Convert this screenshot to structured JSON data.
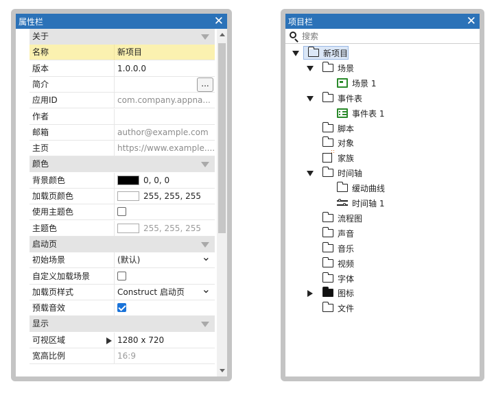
{
  "properties_panel": {
    "title": "属性栏",
    "close_label": "✕",
    "rows": [
      {
        "type": "section",
        "label": "关于"
      },
      {
        "type": "prop",
        "label": "名称",
        "value": "新项目",
        "selected": true
      },
      {
        "type": "prop",
        "label": "版本",
        "value": "1.0.0.0"
      },
      {
        "type": "prop",
        "label": "简介",
        "value": "",
        "button": "..."
      },
      {
        "type": "prop",
        "label": "应用ID",
        "value": "com.company.appna...",
        "grey": true
      },
      {
        "type": "prop",
        "label": "作者",
        "value": ""
      },
      {
        "type": "prop",
        "label": "邮箱",
        "value": "author@example.com",
        "grey": true
      },
      {
        "type": "prop",
        "label": "主页",
        "value": "https://www.example....",
        "grey": true
      },
      {
        "type": "section",
        "label": "颜色"
      },
      {
        "type": "color",
        "label": "背景颜色",
        "value": "0, 0, 0",
        "swatch": "#000000"
      },
      {
        "type": "color",
        "label": "加载页颜色",
        "value": "255, 255, 255",
        "swatch": "#ffffff"
      },
      {
        "type": "check",
        "label": "使用主题色",
        "checked": false
      },
      {
        "type": "color",
        "label": "主题色",
        "value": "255, 255, 255",
        "swatch": "#ffffff",
        "disabled": true
      },
      {
        "type": "section",
        "label": "启动页"
      },
      {
        "type": "select",
        "label": "初始场景",
        "value": "(默认)"
      },
      {
        "type": "check",
        "label": "自定义加载场景",
        "checked": false
      },
      {
        "type": "select",
        "label": "加载页样式",
        "value": "Construct 启动页"
      },
      {
        "type": "check",
        "label": "预载音效",
        "checked": true
      },
      {
        "type": "section",
        "label": "显示"
      },
      {
        "type": "expand",
        "label": "可视区域",
        "value": "1280 x 720"
      },
      {
        "type": "prop",
        "label": "宽高比例",
        "value": "16:9",
        "disabled": true
      }
    ]
  },
  "project_panel": {
    "title": "项目栏",
    "close_label": "✕",
    "search_placeholder": "搜索",
    "tree": [
      {
        "label": "新项目",
        "depth": 0,
        "expand": "open",
        "icon": "folder",
        "selected": true
      },
      {
        "label": "场景",
        "depth": 1,
        "expand": "open",
        "icon": "folder"
      },
      {
        "label": "场景 1",
        "depth": 2,
        "expand": "none",
        "icon": "scene"
      },
      {
        "label": "事件表",
        "depth": 1,
        "expand": "open",
        "icon": "folder"
      },
      {
        "label": "事件表 1",
        "depth": 2,
        "expand": "none",
        "icon": "event-sheet"
      },
      {
        "label": "脚本",
        "depth": 1,
        "expand": "none",
        "icon": "folder"
      },
      {
        "label": "对象",
        "depth": 1,
        "expand": "none",
        "icon": "folder"
      },
      {
        "label": "家族",
        "depth": 1,
        "expand": "none",
        "icon": "family"
      },
      {
        "label": "时间轴",
        "depth": 1,
        "expand": "open",
        "icon": "folder"
      },
      {
        "label": "缓动曲线",
        "depth": 2,
        "expand": "none",
        "icon": "folder"
      },
      {
        "label": "时间轴 1",
        "depth": 2,
        "expand": "none",
        "icon": "timeline"
      },
      {
        "label": "流程图",
        "depth": 1,
        "expand": "none",
        "icon": "folder"
      },
      {
        "label": "声音",
        "depth": 1,
        "expand": "none",
        "icon": "folder"
      },
      {
        "label": "音乐",
        "depth": 1,
        "expand": "none",
        "icon": "folder"
      },
      {
        "label": "视频",
        "depth": 1,
        "expand": "none",
        "icon": "folder"
      },
      {
        "label": "字体",
        "depth": 1,
        "expand": "none",
        "icon": "folder"
      },
      {
        "label": "图标",
        "depth": 1,
        "expand": "closed",
        "icon": "folder-filled"
      },
      {
        "label": "文件",
        "depth": 1,
        "expand": "none",
        "icon": "folder"
      }
    ]
  },
  "colors": {
    "titlebar": "#2b72b8",
    "section_bg": "#e4e4e4",
    "selected_row": "#fbf1b0",
    "checkbox_on": "#1a73d9",
    "scene_icon": "#2a8a2a"
  }
}
